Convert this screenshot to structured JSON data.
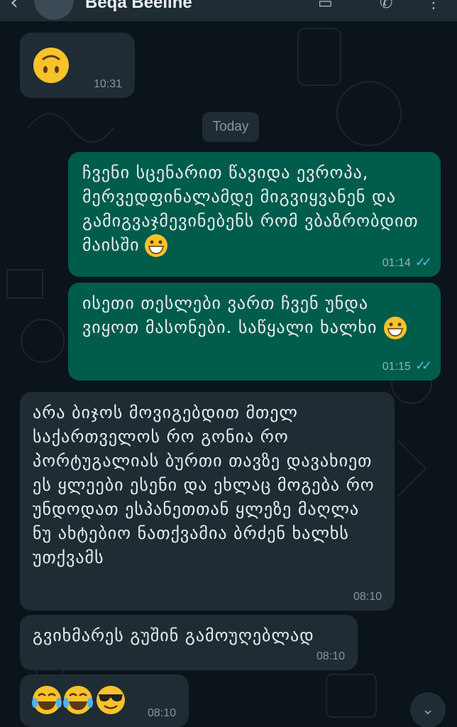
{
  "header": {
    "contact_name": "Beqa Beeline",
    "back_icon": "arrow-left-icon",
    "video_icon": "video-call-icon",
    "call_icon": "phone-icon",
    "menu_icon": "more-vert-icon"
  },
  "date_divider": "Today",
  "messages": [
    {
      "direction": "in",
      "text": "",
      "emoji": [
        "upside-down-face"
      ],
      "time": "10:31"
    },
    {
      "direction": "out",
      "text": "ჩვენი სცენარით წავიდა ევროპა, მერვედფინალამდე მიგვიყვანენ და გამიგვაჯმევინებენს რომ ვბაზრობდით მაისში",
      "emoji": [
        "grinning-face"
      ],
      "time": "01:14",
      "status": "read"
    },
    {
      "direction": "out",
      "text": "ისეთი თესლები ვართ ჩვენ უნდა ვიყოთ მასონები. საწყალი ხალხი",
      "emoji": [
        "grinning-face"
      ],
      "time": "01:15",
      "status": "read"
    },
    {
      "direction": "in",
      "text": "არა ბიჯოს მოვიგებდით მთელ საქართველოს რო გონია რო პორტუგალიას ბურთი თავზე დავახიეთ  ეს ყლეები ესენი და ეხლაც მოგება რო უნდოდათ ესპანეთთან ყლეზე მაღლა ნუ ახტებიო ნათქვამია ბრძენ ხალხს უთქვამს",
      "emoji": [],
      "time": "08:10"
    },
    {
      "direction": "in",
      "text": "გვიხმარეს გუშინ გამოუღებლად",
      "emoji": [],
      "time": "08:10"
    },
    {
      "direction": "in",
      "text": "",
      "emoji": [
        "tears-of-joy",
        "tears-of-joy",
        "sunglasses-face"
      ],
      "time": "08:10"
    }
  ],
  "colors": {
    "background": "#0b141a",
    "incoming": "#1f2c33",
    "outgoing": "#005c4b",
    "read_tick": "#53bdeb"
  },
  "scroll_button_icon": "double-chevron-down-icon"
}
